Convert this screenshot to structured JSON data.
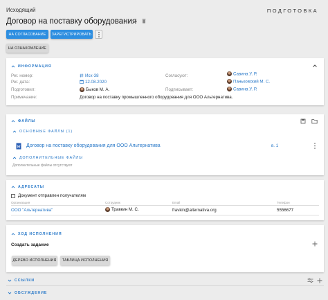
{
  "header": {
    "label": "Исходящий",
    "status": "ПОДГОТОВКА",
    "title": "Договор на поставку оборудования"
  },
  "toolbar": {
    "approve": "НА СОГЛАСОВАНИЕ",
    "register": "ЗАРЕГИСТРИРОВАТЬ",
    "review": "НА ОЗНАКОМЛЕНИЕ"
  },
  "info": {
    "title": "ИНФОРМАЦИЯ",
    "reg_number_label": "Рег. номер:",
    "reg_number": "Исх-38",
    "reg_date_label": "Рег. дата:",
    "reg_date": "12.08.2020",
    "prepared_label": "Подготовил:",
    "prepared": "Быков М. А.",
    "note_label": "Примечание:",
    "note": "Договор на поставку промышленного оборудования для ООО Альтернатива.",
    "approvers_label": "Согласуют:",
    "approver1": "Савина У. Р.",
    "approver2": "Паньковский М. С.",
    "signs_label": "Подписывает:",
    "signer": "Савина У. Р."
  },
  "files": {
    "title": "ФАЙЛЫ",
    "main_title": "ОСНОВНЫЕ ФАЙЛЫ (1)",
    "file_name": "Договор на поставку оборудования для ООО Альтернатива",
    "file_version": "в. 1",
    "extra_title": "ДОПОЛНИТЕЛЬНЫЕ ФАЙЛЫ",
    "extra_empty": "Дополнительные файлы отсутствуют"
  },
  "recipients": {
    "title": "АДРЕСАТЫ",
    "sent_label": "Документ отправлен получателям",
    "columns": [
      "Организация",
      "Сотрудник",
      "Email",
      "Телефон"
    ],
    "row": {
      "org": "ООО \"Альтернатива\"",
      "employee": "Травкин М. С.",
      "email": "fravkin@alternativa.org",
      "phone": "5556677"
    }
  },
  "process": {
    "title": "ХОД ИСПОЛНЕНИЯ",
    "create_task": "Создать задание",
    "tree_btn": "ДЕРЕВО ИСПОЛНЕНИЯ",
    "table_btn": "ТАБЛИЦА ИСПОЛНЕНИЯ"
  },
  "links": {
    "title": "ССЫЛКИ"
  },
  "discussion": {
    "title": "ОБСУЖДЕНИЕ"
  },
  "colors": {
    "accent": "#2d8ee0",
    "link": "#2878c8",
    "bg": "#ececec"
  }
}
